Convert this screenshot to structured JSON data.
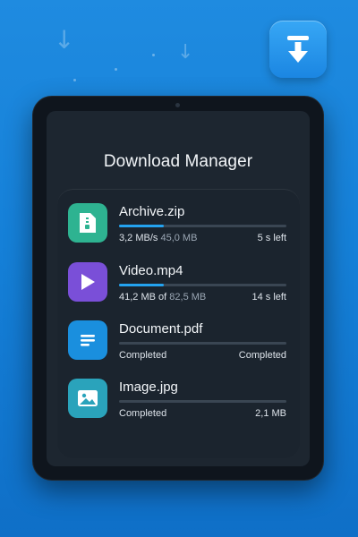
{
  "app": {
    "title": "Download Manager",
    "accent_color": "#24a3f0",
    "app_icon": "download-arrow-icon"
  },
  "downloads": [
    {
      "name": "Archive.zip",
      "icon": "zip-file-icon",
      "icon_color": "#2eb391",
      "progress": 0.27,
      "speed": "3,2 MB/s",
      "size": "45,0 MB",
      "time_left": "5 s left"
    },
    {
      "name": "Video.mp4",
      "icon": "play-icon",
      "icon_color": "#7a4fd8",
      "progress": 0.27,
      "downloaded": "41,2 MB",
      "of_word": "of",
      "total": "82,5 MB",
      "time_left": "14 s left"
    },
    {
      "name": "Document.pdf",
      "icon": "document-icon",
      "icon_color": "#1a8fde",
      "progress": 0,
      "status": "Completed",
      "right_status": "Completed"
    },
    {
      "name": "Image.jpg",
      "icon": "image-icon",
      "icon_color": "#2aa3bb",
      "progress": 0,
      "status": "Completed",
      "size": "2,1 MB"
    }
  ]
}
